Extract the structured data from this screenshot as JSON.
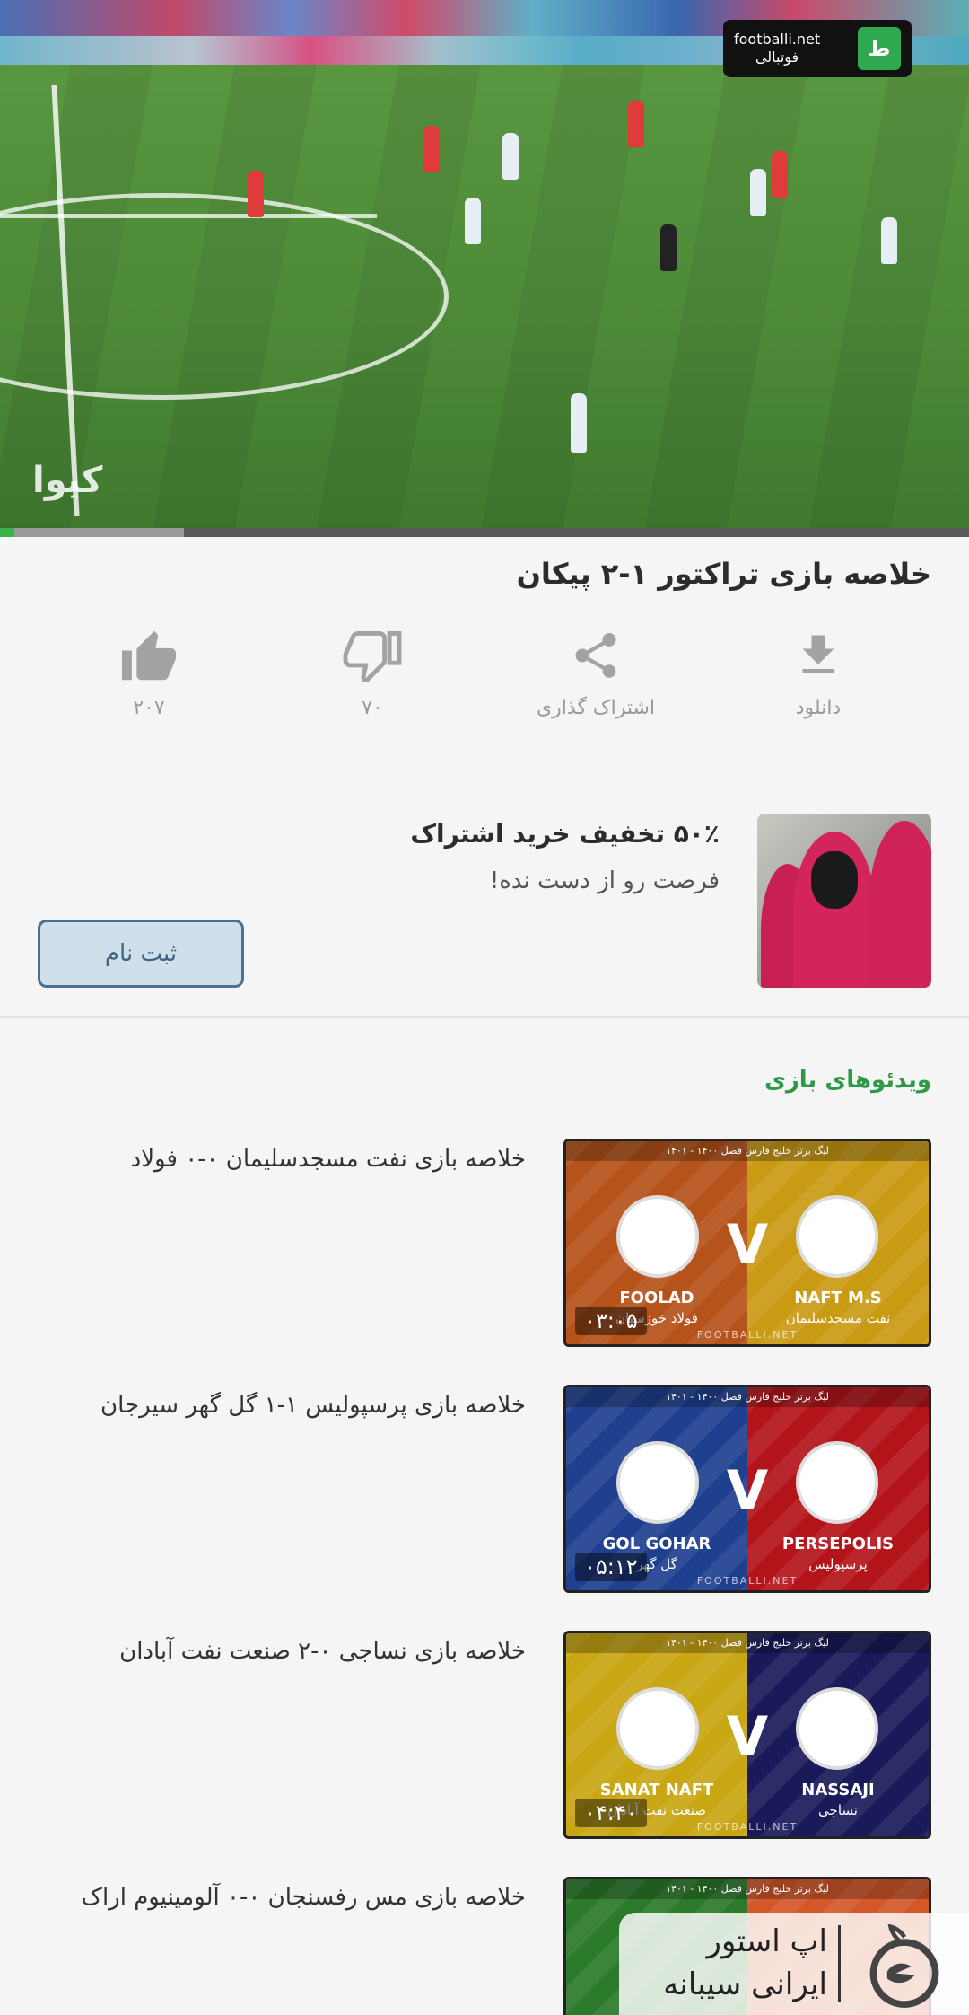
{
  "player": {
    "broadcaster_text": "فوتبالی",
    "broadcaster_url": "footballi.net",
    "watermark": "کیوا",
    "progress_played": 0.015,
    "progress_buffered": 0.19
  },
  "video": {
    "title": "خلاصه بازی تراکتور ۱-۲ پیکان"
  },
  "actions": [
    {
      "id": "like",
      "icon": "thumbs-up-icon",
      "label": "۲۰۷"
    },
    {
      "id": "dislike",
      "icon": "thumbs-down-icon",
      "label": "۷۰"
    },
    {
      "id": "share",
      "icon": "share-icon",
      "label": "اشتراک گذاری"
    },
    {
      "id": "download",
      "icon": "download-icon",
      "label": "دانلود"
    }
  ],
  "promo": {
    "title": "۵۰٪ تخفیف خرید اشتراک",
    "subtitle": "فرصت رو از دست نده!",
    "button": "ثبت نام"
  },
  "related": {
    "section_title": "ویدئوهای بازی",
    "league_banner": "لیگ برتر خلیج فارس فصل ۱۴۰۰ - ۱۴۰۱",
    "site": "FOOTBALLI.NET",
    "vs": "V",
    "items": [
      {
        "title": "خلاصه بازی نفت مسجدسلیمان ۰-۰ فولاد",
        "duration": "۰۳:۰۵",
        "left_team_en": "FOOLAD",
        "left_team_fa": "فولاد خوزستان",
        "right_team_en": "NAFT M.S",
        "right_team_fa": "نفت مسجدسلیمان",
        "left_color": "#b5531a",
        "right_color": "#c99a14"
      },
      {
        "title": "خلاصه بازی پرسپولیس ۱-۱ گل گهر سیرجان",
        "duration": "۰۵:۱۲",
        "left_team_en": "GOL GOHAR",
        "left_team_fa": "گل گهر",
        "right_team_en": "PERSEPOLIS",
        "right_team_fa": "پرسپولیس",
        "left_color": "#1f3f8f",
        "right_color": "#b3141a"
      },
      {
        "title": "خلاصه بازی نساجی ۰-۲ صنعت نفت آبادان",
        "duration": "۰۴:۴۰",
        "left_team_en": "SANAT NAFT",
        "left_team_fa": "صنعت نفت آبادان",
        "right_team_en": "NASSAJI",
        "right_team_fa": "نساجی",
        "left_color": "#c9a614",
        "right_color": "#1a1a5a"
      },
      {
        "title": "خلاصه بازی مس رفسنجان ۰-۰ آلومینیوم اراک",
        "duration": "",
        "left_team_en": "",
        "left_team_fa": "",
        "right_team_en": "",
        "right_team_fa": "",
        "left_color": "#2b7a2b",
        "right_color": "#d4572a"
      }
    ]
  },
  "store_banner": {
    "text": "اپ استور ایرانی سیبانه"
  },
  "colors": {
    "accent_green": "#2e9a48",
    "progress_green": "#38b34a",
    "button_border": "#4a7090"
  }
}
